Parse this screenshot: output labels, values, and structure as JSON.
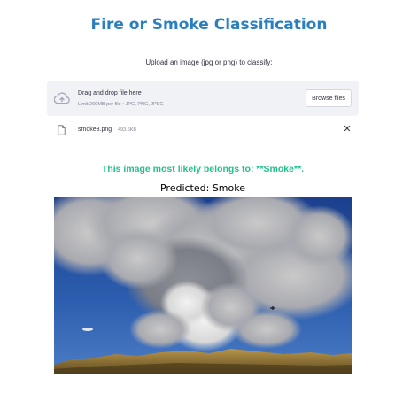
{
  "app": {
    "title": "Fire or Smoke Classification"
  },
  "uploader": {
    "label": "Upload an image (jpg or png) to classify:",
    "drop_title": "Drag and drop file here",
    "limit_text": "Limit 200MB per file • JPG, PNG, JPEG",
    "browse_label": "Browse files",
    "cloud_icon": "cloud-upload-icon"
  },
  "file": {
    "name": "smoke3.png",
    "size": "493.6KB",
    "icon": "file-icon",
    "remove_icon": "close-icon"
  },
  "result": {
    "message": "This image most likely belongs to: **Smoke**.",
    "predicted": "Predicted: Smoke"
  },
  "colors": {
    "title": "#2a7fc0",
    "result": "#21c08b",
    "dropzone_bg": "#f0f2f6"
  }
}
